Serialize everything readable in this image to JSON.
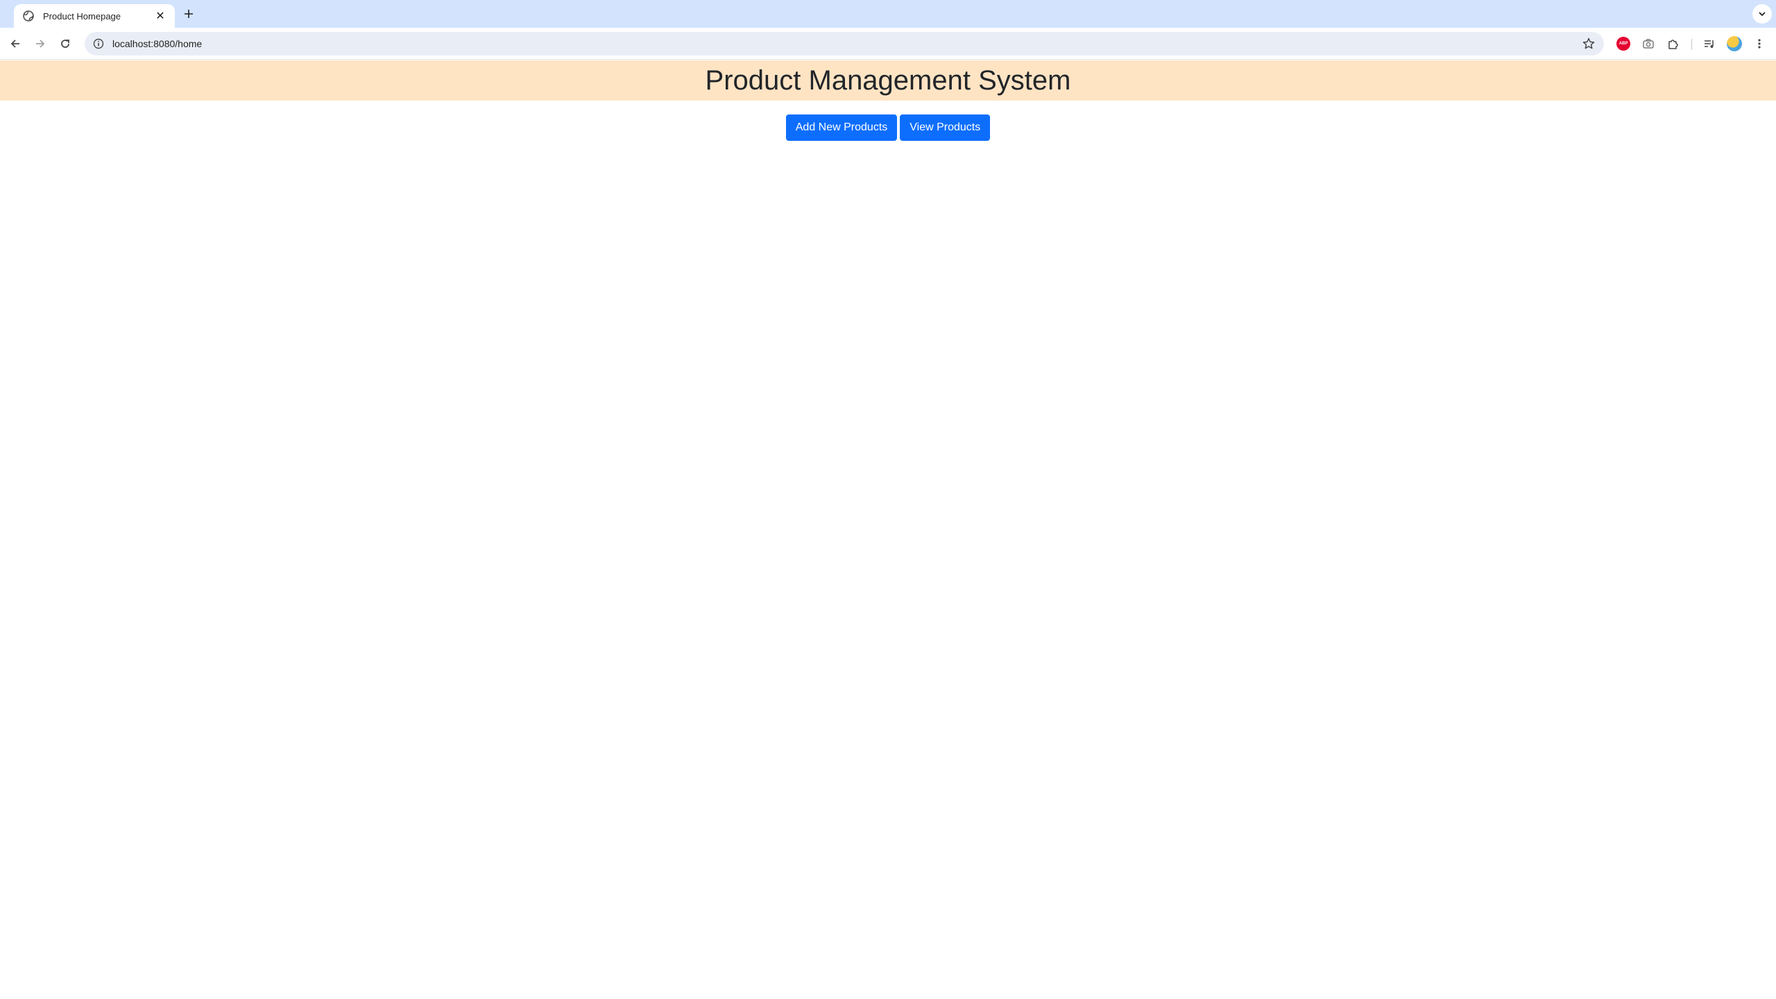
{
  "browser": {
    "tab": {
      "title": "Product Homepage",
      "icon": "globe-icon"
    },
    "address_bar": {
      "url": "localhost:8080/home"
    },
    "extensions": [
      "adblock-plus-icon",
      "camera-icon",
      "puzzle-piece-icon",
      "media-control-icon"
    ]
  },
  "page": {
    "header": {
      "title": "Product Management System",
      "background_color": "#ffe4c4"
    },
    "actions": {
      "add_label": "Add New Products",
      "view_label": "View Products",
      "button_color": "#0d6efd"
    },
    "icon_text": {
      "abp": "ABP"
    }
  }
}
